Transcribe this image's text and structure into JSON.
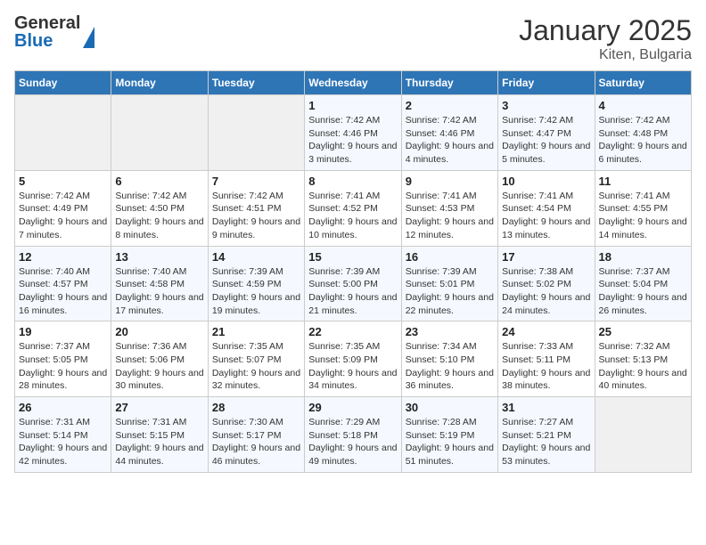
{
  "header": {
    "logo_general": "General",
    "logo_blue": "Blue",
    "title": "January 2025",
    "subtitle": "Kiten, Bulgaria"
  },
  "columns": [
    "Sunday",
    "Monday",
    "Tuesday",
    "Wednesday",
    "Thursday",
    "Friday",
    "Saturday"
  ],
  "weeks": [
    [
      {
        "day": "",
        "info": ""
      },
      {
        "day": "",
        "info": ""
      },
      {
        "day": "",
        "info": ""
      },
      {
        "day": "1",
        "info": "Sunrise: 7:42 AM\nSunset: 4:46 PM\nDaylight: 9 hours and 3 minutes."
      },
      {
        "day": "2",
        "info": "Sunrise: 7:42 AM\nSunset: 4:46 PM\nDaylight: 9 hours and 4 minutes."
      },
      {
        "day": "3",
        "info": "Sunrise: 7:42 AM\nSunset: 4:47 PM\nDaylight: 9 hours and 5 minutes."
      },
      {
        "day": "4",
        "info": "Sunrise: 7:42 AM\nSunset: 4:48 PM\nDaylight: 9 hours and 6 minutes."
      }
    ],
    [
      {
        "day": "5",
        "info": "Sunrise: 7:42 AM\nSunset: 4:49 PM\nDaylight: 9 hours and 7 minutes."
      },
      {
        "day": "6",
        "info": "Sunrise: 7:42 AM\nSunset: 4:50 PM\nDaylight: 9 hours and 8 minutes."
      },
      {
        "day": "7",
        "info": "Sunrise: 7:42 AM\nSunset: 4:51 PM\nDaylight: 9 hours and 9 minutes."
      },
      {
        "day": "8",
        "info": "Sunrise: 7:41 AM\nSunset: 4:52 PM\nDaylight: 9 hours and 10 minutes."
      },
      {
        "day": "9",
        "info": "Sunrise: 7:41 AM\nSunset: 4:53 PM\nDaylight: 9 hours and 12 minutes."
      },
      {
        "day": "10",
        "info": "Sunrise: 7:41 AM\nSunset: 4:54 PM\nDaylight: 9 hours and 13 minutes."
      },
      {
        "day": "11",
        "info": "Sunrise: 7:41 AM\nSunset: 4:55 PM\nDaylight: 9 hours and 14 minutes."
      }
    ],
    [
      {
        "day": "12",
        "info": "Sunrise: 7:40 AM\nSunset: 4:57 PM\nDaylight: 9 hours and 16 minutes."
      },
      {
        "day": "13",
        "info": "Sunrise: 7:40 AM\nSunset: 4:58 PM\nDaylight: 9 hours and 17 minutes."
      },
      {
        "day": "14",
        "info": "Sunrise: 7:39 AM\nSunset: 4:59 PM\nDaylight: 9 hours and 19 minutes."
      },
      {
        "day": "15",
        "info": "Sunrise: 7:39 AM\nSunset: 5:00 PM\nDaylight: 9 hours and 21 minutes."
      },
      {
        "day": "16",
        "info": "Sunrise: 7:39 AM\nSunset: 5:01 PM\nDaylight: 9 hours and 22 minutes."
      },
      {
        "day": "17",
        "info": "Sunrise: 7:38 AM\nSunset: 5:02 PM\nDaylight: 9 hours and 24 minutes."
      },
      {
        "day": "18",
        "info": "Sunrise: 7:37 AM\nSunset: 5:04 PM\nDaylight: 9 hours and 26 minutes."
      }
    ],
    [
      {
        "day": "19",
        "info": "Sunrise: 7:37 AM\nSunset: 5:05 PM\nDaylight: 9 hours and 28 minutes."
      },
      {
        "day": "20",
        "info": "Sunrise: 7:36 AM\nSunset: 5:06 PM\nDaylight: 9 hours and 30 minutes."
      },
      {
        "day": "21",
        "info": "Sunrise: 7:35 AM\nSunset: 5:07 PM\nDaylight: 9 hours and 32 minutes."
      },
      {
        "day": "22",
        "info": "Sunrise: 7:35 AM\nSunset: 5:09 PM\nDaylight: 9 hours and 34 minutes."
      },
      {
        "day": "23",
        "info": "Sunrise: 7:34 AM\nSunset: 5:10 PM\nDaylight: 9 hours and 36 minutes."
      },
      {
        "day": "24",
        "info": "Sunrise: 7:33 AM\nSunset: 5:11 PM\nDaylight: 9 hours and 38 minutes."
      },
      {
        "day": "25",
        "info": "Sunrise: 7:32 AM\nSunset: 5:13 PM\nDaylight: 9 hours and 40 minutes."
      }
    ],
    [
      {
        "day": "26",
        "info": "Sunrise: 7:31 AM\nSunset: 5:14 PM\nDaylight: 9 hours and 42 minutes."
      },
      {
        "day": "27",
        "info": "Sunrise: 7:31 AM\nSunset: 5:15 PM\nDaylight: 9 hours and 44 minutes."
      },
      {
        "day": "28",
        "info": "Sunrise: 7:30 AM\nSunset: 5:17 PM\nDaylight: 9 hours and 46 minutes."
      },
      {
        "day": "29",
        "info": "Sunrise: 7:29 AM\nSunset: 5:18 PM\nDaylight: 9 hours and 49 minutes."
      },
      {
        "day": "30",
        "info": "Sunrise: 7:28 AM\nSunset: 5:19 PM\nDaylight: 9 hours and 51 minutes."
      },
      {
        "day": "31",
        "info": "Sunrise: 7:27 AM\nSunset: 5:21 PM\nDaylight: 9 hours and 53 minutes."
      },
      {
        "day": "",
        "info": ""
      }
    ]
  ]
}
